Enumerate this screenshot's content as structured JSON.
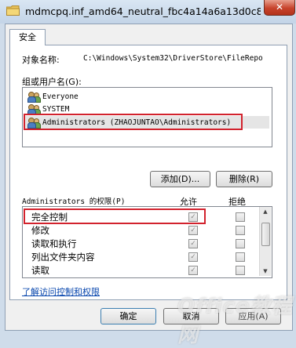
{
  "window": {
    "title": "mdmcpq.inf_amd64_neutral_fbc4a14a6a13d0c8"
  },
  "tabs": [
    {
      "label": "安全"
    }
  ],
  "object": {
    "label": "对象名称:",
    "value": "C:\\Windows\\System32\\DriverStore\\FileRepo"
  },
  "groups": {
    "label": "组或用户名(G):",
    "users": [
      {
        "name": "Everyone"
      },
      {
        "name": "SYSTEM"
      },
      {
        "name": "Administrators (ZHAOJUNTAO\\Administrators)",
        "selected": true
      }
    ],
    "add_label": "添加(D)...",
    "remove_label": "删除(R)"
  },
  "permissions": {
    "header": "Administrators 的权限(P)",
    "allow_header": "允许",
    "deny_header": "拒绝",
    "rows": [
      {
        "name": "完全控制",
        "allow": true,
        "deny": false
      },
      {
        "name": "修改",
        "allow": true,
        "deny": false
      },
      {
        "name": "读取和执行",
        "allow": true,
        "deny": false
      },
      {
        "name": "列出文件夹内容",
        "allow": true,
        "deny": false
      },
      {
        "name": "读取",
        "allow": true,
        "deny": false
      }
    ]
  },
  "link": {
    "label": "了解访问控制和权限"
  },
  "footer": {
    "ok_label": "确定",
    "cancel_label": "取消",
    "apply_label": "应用(A)"
  },
  "watermark": {
    "text": "Office教程网"
  },
  "colors": {
    "highlight": "#d2222d",
    "link": "#0645ad"
  }
}
